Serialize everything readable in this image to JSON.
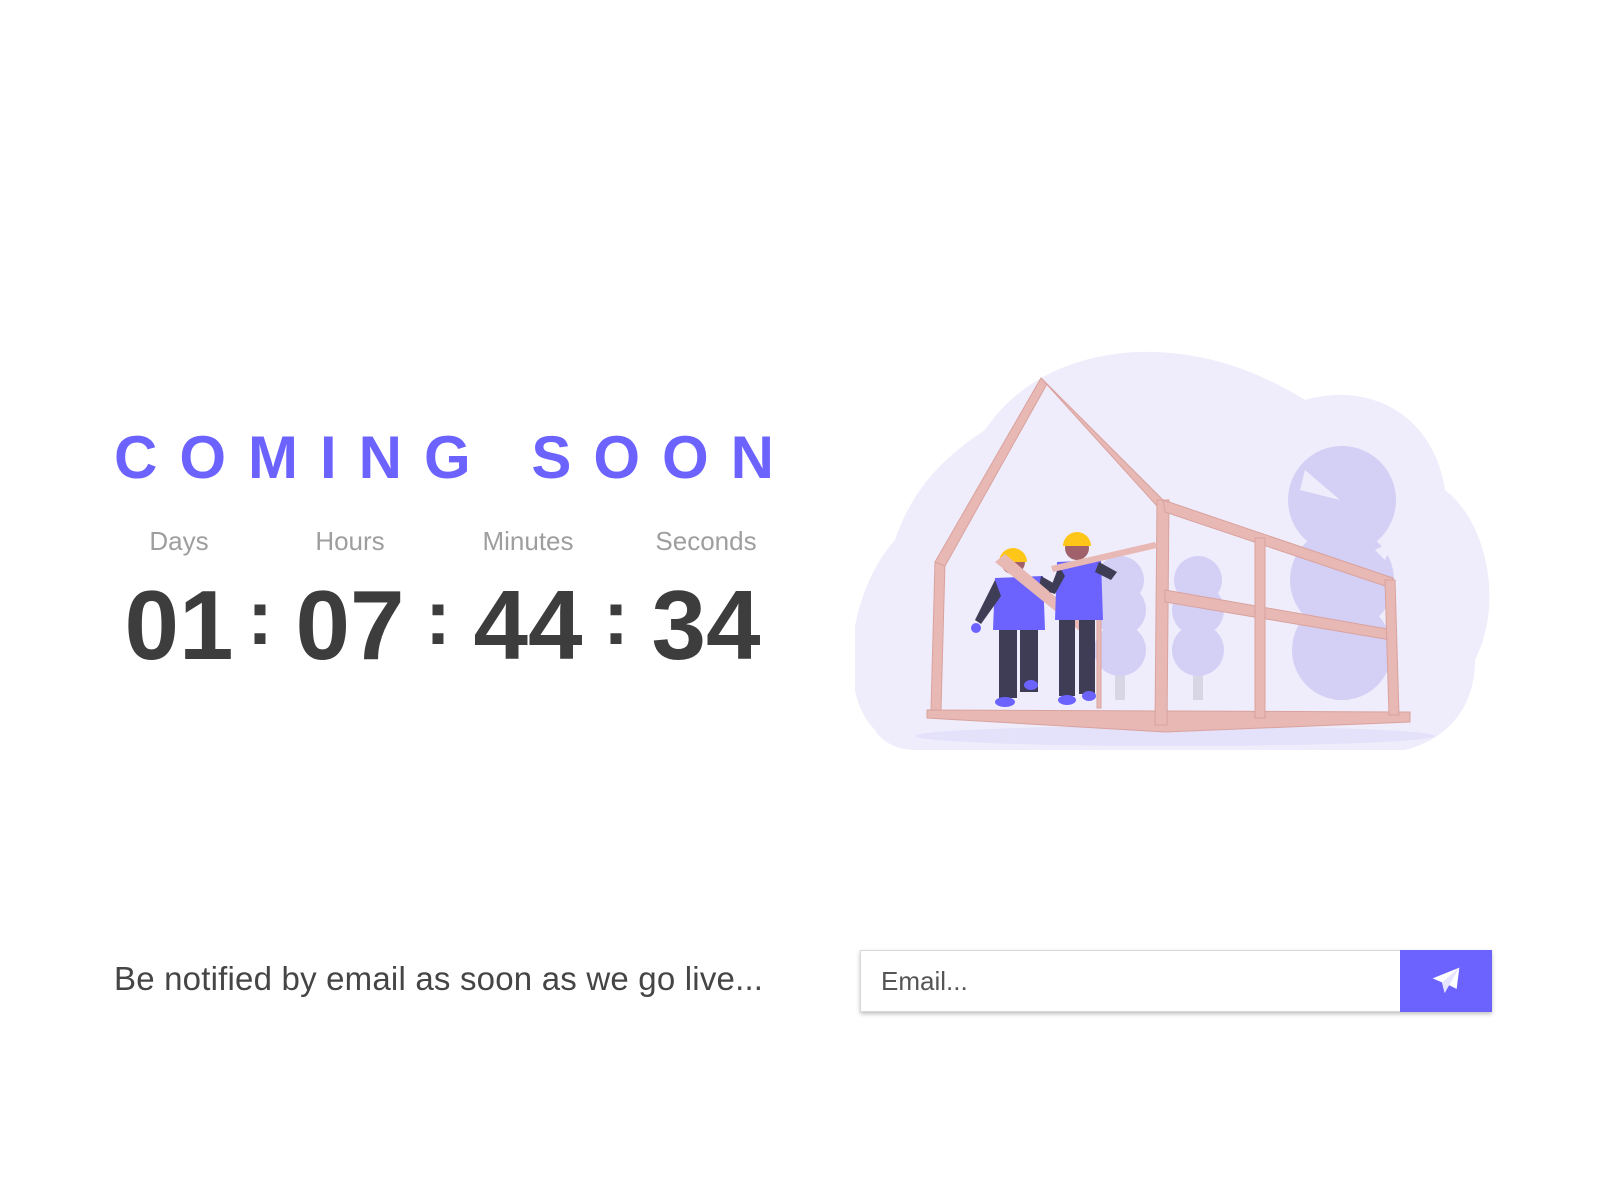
{
  "header": {
    "title": "COMING SOON"
  },
  "countdown": {
    "units": [
      {
        "label": "Days",
        "value": "01"
      },
      {
        "label": "Hours",
        "value": "07"
      },
      {
        "label": "Minutes",
        "value": "44"
      },
      {
        "label": "Seconds",
        "value": "34"
      }
    ],
    "separator": ":"
  },
  "notify": {
    "text": "Be notified by email as soon as we go live...",
    "email_placeholder": "Email...",
    "submit_icon": "paper-plane-icon"
  },
  "colors": {
    "accent": "#6c63ff",
    "digits": "#3d3d3d",
    "labels": "#9e9e9e",
    "frame": "#e8b8b4",
    "cloud": "#efedfb"
  }
}
